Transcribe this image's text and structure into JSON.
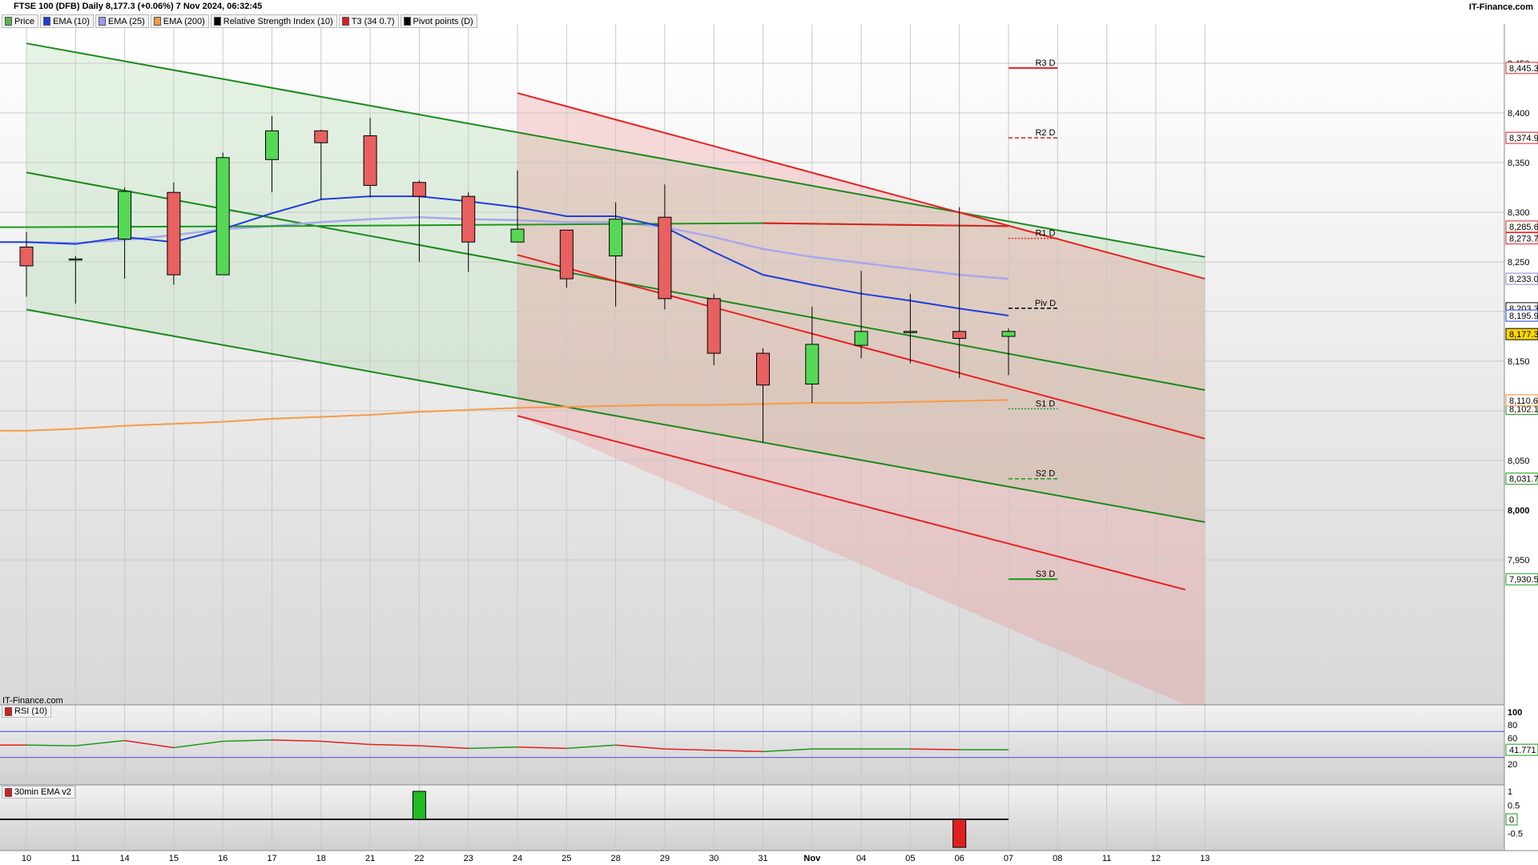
{
  "header": {
    "title": "FTSE 100 (DFB) Daily 8,177.3 (+0.06%) 7 Nov 2024, 06:32:45",
    "brand": "IT-Finance.com",
    "watermark": "IT-Finance.com"
  },
  "legend": [
    {
      "label": "Price",
      "color": "#59b359"
    },
    {
      "label": "EMA (10)",
      "color": "#1f3fd8"
    },
    {
      "label": "EMA (25)",
      "color": "#9999ee"
    },
    {
      "label": "EMA (200)",
      "color": "#f79a46"
    },
    {
      "label": "Relative Strength Index (10)",
      "color": "#000000"
    },
    {
      "label": "T3 (34 0.7)",
      "color": "#d62020"
    },
    {
      "label": "Pivot points (D)",
      "color": "#000000"
    }
  ],
  "chart_data": {
    "type": "candlestick",
    "x_tick_labels": [
      "10",
      "11",
      "14",
      "15",
      "16",
      "17",
      "18",
      "21",
      "22",
      "23",
      "24",
      "25",
      "28",
      "29",
      "30",
      "31",
      "Nov",
      "04",
      "05",
      "06",
      "07",
      "08",
      "11",
      "12",
      "13"
    ],
    "y_ticks": [
      "8,450",
      "8,400",
      "8,350",
      "8,300",
      "8,250",
      "8,200",
      "8,150",
      "8,100",
      "8,050",
      "8,000",
      "7,950"
    ],
    "ylim": [
      7920,
      8480
    ],
    "candles": [
      {
        "o": 8265,
        "h": 8280,
        "l": 8215,
        "c": 8246
      },
      {
        "o": 8252,
        "h": 8256,
        "l": 8208,
        "c": 8253
      },
      {
        "o": 8273,
        "h": 8325,
        "l": 8233,
        "c": 8321
      },
      {
        "o": 8320,
        "h": 8330,
        "l": 8227,
        "c": 8237
      },
      {
        "o": 8237,
        "h": 8360,
        "l": 8237,
        "c": 8355
      },
      {
        "o": 8353,
        "h": 8397,
        "l": 8320,
        "c": 8382
      },
      {
        "o": 8382,
        "h": 8383,
        "l": 8313,
        "c": 8370
      },
      {
        "o": 8377,
        "h": 8395,
        "l": 8315,
        "c": 8327
      },
      {
        "o": 8330,
        "h": 8332,
        "l": 8250,
        "c": 8316
      },
      {
        "o": 8316,
        "h": 8320,
        "l": 8240,
        "c": 8270
      },
      {
        "o": 8270,
        "h": 8342,
        "l": 8270,
        "c": 8283
      },
      {
        "o": 8282,
        "h": 8282,
        "l": 8224,
        "c": 8233
      },
      {
        "o": 8256,
        "h": 8310,
        "l": 8205,
        "c": 8293
      },
      {
        "o": 8295,
        "h": 8328,
        "l": 8202,
        "c": 8213
      },
      {
        "o": 8213,
        "h": 8218,
        "l": 8146,
        "c": 8158
      },
      {
        "o": 8158,
        "h": 8163,
        "l": 8068,
        "c": 8126
      },
      {
        "o": 8127,
        "h": 8205,
        "l": 8108,
        "c": 8167
      },
      {
        "o": 8166,
        "h": 8241,
        "l": 8153,
        "c": 8180
      },
      {
        "o": 8180,
        "h": 8218,
        "l": 8148,
        "c": 8180
      },
      {
        "o": 8180,
        "h": 8305,
        "l": 8133,
        "c": 8173
      },
      {
        "o": 8175,
        "h": 8183,
        "l": 8136,
        "c": 8180
      }
    ],
    "ema10": [
      8270,
      8268,
      8275,
      8270,
      8283,
      8299,
      8313,
      8316,
      8316,
      8311,
      8305,
      8296,
      8296,
      8285,
      8260,
      8237,
      8227,
      8218,
      8211,
      8203,
      8196
    ],
    "ema25": [
      8270,
      8269,
      8272,
      8277,
      8283,
      8286,
      8290,
      8293,
      8295,
      8293,
      8292,
      8290,
      8290,
      8285,
      8275,
      8263,
      8255,
      8249,
      8243,
      8237,
      8233
    ],
    "ema200": [
      8080,
      8082,
      8085,
      8087,
      8089,
      8092,
      8094,
      8096,
      8099,
      8101,
      8103,
      8104,
      8105,
      8106,
      8106,
      8107,
      8108,
      8108,
      8109,
      8110,
      8111
    ],
    "t3": [
      {
        "i": 0,
        "v": 8285
      },
      {
        "i": 5,
        "v": 8286
      },
      {
        "i": 15,
        "v": 8289
      },
      {
        "i": 20,
        "v": 8286
      }
    ],
    "pivots": [
      {
        "name": "R3 D",
        "value": 8445.3,
        "label": "8,445.3",
        "color": "#e02020",
        "style": "solid"
      },
      {
        "name": "R2 D",
        "value": 8374.9,
        "label": "8,374.9",
        "color": "#e02020",
        "style": "dashed"
      },
      {
        "name": "R1 D",
        "value": 8273.7,
        "label": "8,273.7",
        "color": "#e02020",
        "style": "dotted"
      },
      {
        "name": "Piv D",
        "value": 8203.3,
        "label": "8,203.3",
        "color": "#000000",
        "style": "dashed"
      },
      {
        "name": "S1 D",
        "value": 8102.1,
        "label": "8,102.1",
        "color": "#1a9a1a",
        "style": "dotted"
      },
      {
        "name": "S2 D",
        "value": 8031.7,
        "label": "8,031.7",
        "color": "#1a9a1a",
        "style": "dashed"
      },
      {
        "name": "S3 D",
        "value": 7930.5,
        "label": "7,930.5",
        "color": "#1a9a1a",
        "style": "solid"
      }
    ],
    "axis_badges": [
      {
        "value": 8285.6,
        "label": "8,285.6",
        "color": "#e02020"
      },
      {
        "value": 8233.0,
        "label": "8,233.0",
        "color": "#8888dd"
      },
      {
        "value": 8195.9,
        "label": "8,195.9",
        "color": "#1f3fd8"
      },
      {
        "value": 8177.3,
        "label": "8,177.3",
        "color": "#000000",
        "bg": "#ffd600"
      },
      {
        "value": 8110.6,
        "label": "8,110.6",
        "color": "#f08a2a"
      }
    ],
    "green_channel": {
      "upper": [
        {
          "i": 0,
          "v": 8470
        },
        {
          "i": 24,
          "v": 8255
        }
      ],
      "mid": [
        {
          "i": 0,
          "v": 8340
        },
        {
          "i": 24,
          "v": 8121
        }
      ],
      "lower": [
        {
          "i": 0,
          "v": 8202
        },
        {
          "i": 24,
          "v": 7988
        }
      ]
    },
    "red_channel": {
      "upper": [
        {
          "i": 10,
          "v": 8420
        },
        {
          "i": 24,
          "v": 8233
        }
      ],
      "mid": [
        {
          "i": 10,
          "v": 8257
        },
        {
          "i": 24,
          "v": 8072
        }
      ],
      "lower": [
        {
          "i": 10,
          "v": 8095
        },
        {
          "i": 23.6,
          "v": 7920
        }
      ]
    },
    "rsi": {
      "label": "RSI (10)",
      "ticks": [
        "100",
        "80",
        "60",
        "40",
        "20"
      ],
      "ylim": [
        0,
        100
      ],
      "bands": [
        70,
        30
      ],
      "values": [
        49,
        48,
        56,
        45,
        55,
        57,
        55,
        50,
        48,
        44,
        46,
        44,
        49,
        43,
        41,
        39,
        43,
        43,
        43,
        42,
        41.771
      ],
      "colors": [
        "r",
        "g",
        "g",
        "r",
        "g",
        "g",
        "r",
        "r",
        "r",
        "r",
        "g",
        "r",
        "g",
        "r",
        "r",
        "r",
        "g",
        "g",
        "g",
        "r",
        "g"
      ],
      "badge": "41.771"
    },
    "ema30": {
      "label": "30min EMA v2",
      "ticks": [
        "1",
        "0.5",
        "0",
        "-0.5"
      ],
      "ylim": [
        -1,
        1.1
      ],
      "bars": [
        {
          "i": 8,
          "v": 1
        },
        {
          "i": 19,
          "v": -1
        }
      ],
      "badge": "0"
    }
  }
}
